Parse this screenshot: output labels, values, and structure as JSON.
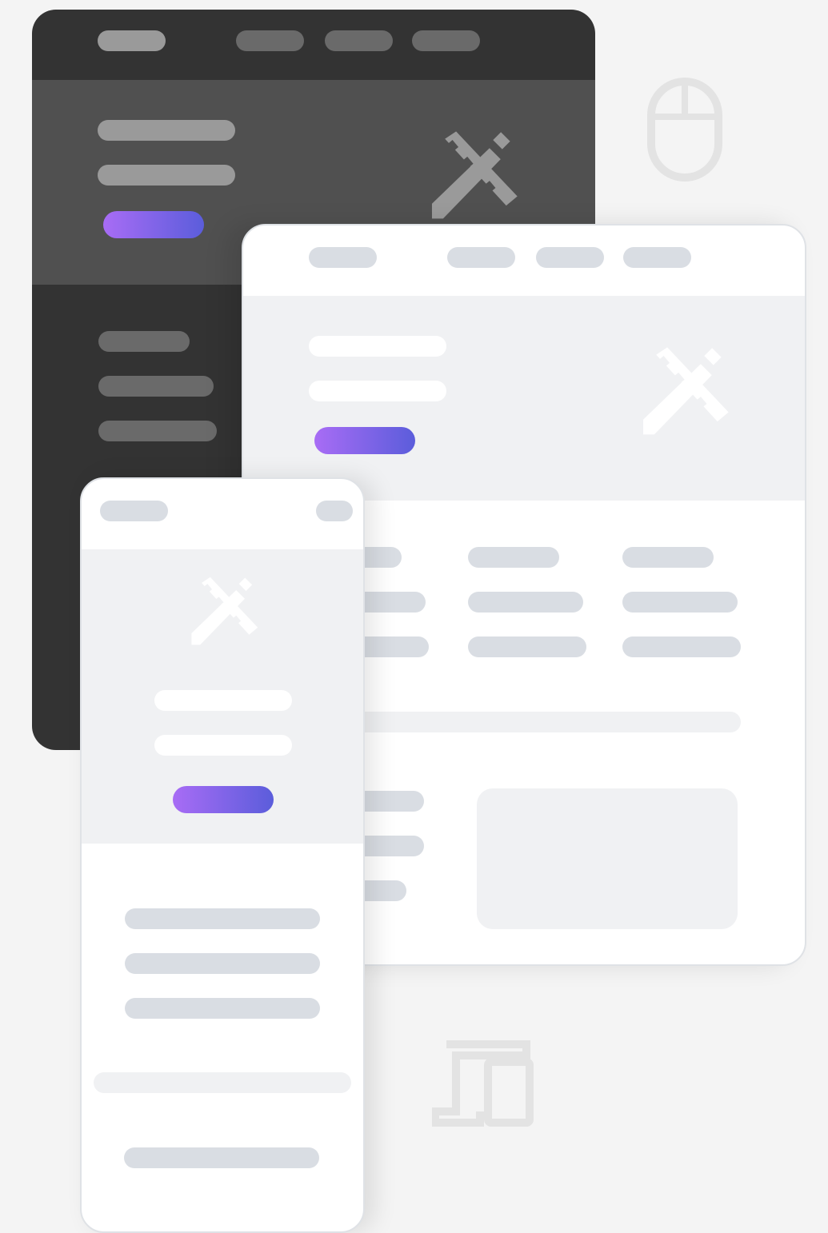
{
  "colors": {
    "background": "#f4f4f4",
    "dark_window": "#333333",
    "dark_hero": "#505050",
    "light_window": "#ffffff",
    "light_hero": "#f0f1f3",
    "placeholder_bar": "#d9dde3",
    "accent_gradient_start": "#a86cf5",
    "accent_gradient_end": "#5b5ddb",
    "background_icon": "#e3e3e3"
  },
  "icons": {
    "design_tools": "pencil-ruler-icon",
    "mouse": "mouse-icon",
    "devices": "responsive-devices-icon"
  }
}
